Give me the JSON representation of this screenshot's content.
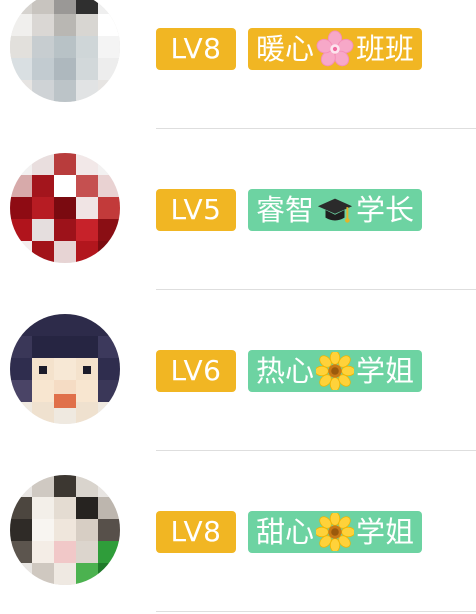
{
  "colors": {
    "level_badge": "#f1b623",
    "title_badge_yellow": "#f1b623",
    "title_badge_green": "#6dd3a2"
  },
  "rows": [
    {
      "avatar": "avatar-pixelated",
      "level": "LV8",
      "title_left": "暖心",
      "title_icon": "cherry-blossom-icon",
      "title_right": "班班",
      "title_color": "#f1b623"
    },
    {
      "avatar": "avatar-pixelated",
      "level": "LV5",
      "title_left": "睿智",
      "title_icon": "graduation-cap-icon",
      "title_right": "学长",
      "title_color": "#6dd3a2"
    },
    {
      "avatar": "avatar-pixelated",
      "level": "LV6",
      "title_left": "热心",
      "title_icon": "sunflower-icon",
      "title_right": "学姐",
      "title_color": "#6dd3a2"
    },
    {
      "avatar": "avatar-pixelated",
      "level": "LV8",
      "title_left": "甜心",
      "title_icon": "sunflower-icon",
      "title_right": "学姐",
      "title_color": "#6dd3a2"
    }
  ]
}
